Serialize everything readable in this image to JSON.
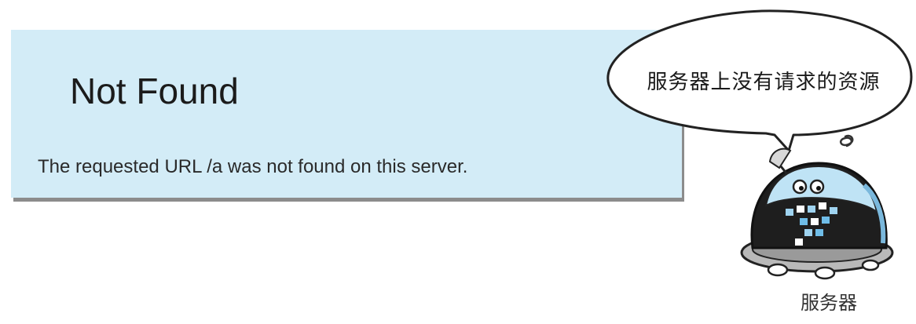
{
  "error_page": {
    "title": "Not Found",
    "message": "The requested URL /a was not found on this server."
  },
  "bubble": {
    "text": "服务器上没有请求的资源"
  },
  "server": {
    "label": "服务器",
    "icon": "server-robot-icon"
  },
  "colors": {
    "panel_background": "#d3ecf7",
    "panel_shadow": "#8c8c8c",
    "robot_body": "#1e1e1e",
    "robot_dome": "#bfe3f5"
  }
}
